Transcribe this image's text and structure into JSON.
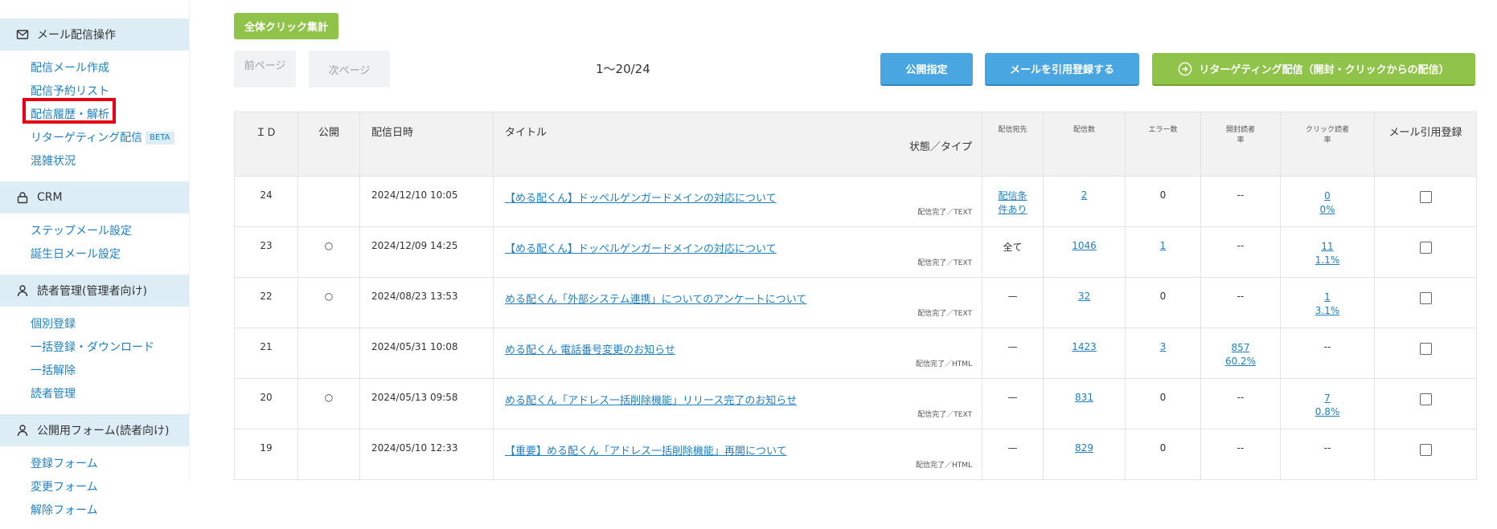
{
  "sidebar": {
    "sections": [
      {
        "title": "メール配信操作",
        "icon": "mail-icon",
        "items": [
          {
            "label": "配信メール作成"
          },
          {
            "label": "配信予約リスト"
          },
          {
            "label": "配信履歴・解析",
            "active": true
          },
          {
            "label": "リターゲティング配信",
            "badge": "BETA"
          },
          {
            "label": "混雑状況"
          }
        ]
      },
      {
        "title": "CRM",
        "icon": "lock-icon",
        "items": [
          {
            "label": "ステップメール設定"
          },
          {
            "label": "誕生日メール設定"
          }
        ]
      },
      {
        "title": "読者管理(管理者向け)",
        "icon": "user-icon",
        "items": [
          {
            "label": "個別登録"
          },
          {
            "label": "一括登録・ダウンロード"
          },
          {
            "label": "一括解除"
          },
          {
            "label": "読者管理"
          }
        ]
      },
      {
        "title": "公開用フォーム(読者向け)",
        "icon": "user-icon",
        "items": [
          {
            "label": "登録フォーム"
          },
          {
            "label": "変更フォーム"
          },
          {
            "label": "解除フォーム"
          }
        ]
      }
    ]
  },
  "toolbar": {
    "total_click_label": "全体クリック集計",
    "prev_label": "前ページ",
    "next_label": "次ページ",
    "range": "1〜20/24",
    "publish_label": "公開指定",
    "quote_label": "メールを引用登録する",
    "retarget_label": "リターゲティング配信（開封・クリックからの配信）"
  },
  "table": {
    "headers": {
      "id": "ＩＤ",
      "public": "公開",
      "date": "配信日時",
      "title": "タイトル",
      "status_type": "状態／タイプ",
      "dest": "配信宛先",
      "count": "配信数",
      "errors": "エラー数",
      "open_rate_1": "開封読者",
      "open_rate_2": "率",
      "click_rate_1": "クリック読者",
      "click_rate_2": "率",
      "quote": "メール引用登録"
    },
    "rows": [
      {
        "id": "24",
        "public": "",
        "date": "2024/12/10 10:05",
        "title": "【める配くん】ドッペルゲンガードメインの対応について",
        "status": "配信完了／TEXT",
        "dest": "配信条件あり",
        "dest_link": true,
        "count": "2",
        "errors": "0",
        "errors_link": false,
        "open1": "--",
        "open2": "",
        "click1": "0",
        "click2": "0%",
        "click_link": true
      },
      {
        "id": "23",
        "public": "○",
        "date": "2024/12/09 14:25",
        "title": "【める配くん】ドッペルゲンガードメインの対応について",
        "status": "配信完了／TEXT",
        "dest": "全て",
        "dest_link": false,
        "count": "1046",
        "errors": "1",
        "errors_link": true,
        "open1": "--",
        "open2": "",
        "click1": "11",
        "click2": "1.1%",
        "click_link": true
      },
      {
        "id": "22",
        "public": "○",
        "date": "2024/08/23 13:53",
        "title": "める配くん「外部システム連携」についてのアンケートについて",
        "status": "配信完了／TEXT",
        "dest": "—",
        "dest_link": false,
        "count": "32",
        "errors": "0",
        "errors_link": false,
        "open1": "--",
        "open2": "",
        "click1": "1",
        "click2": "3.1%",
        "click_link": true
      },
      {
        "id": "21",
        "public": "",
        "date": "2024/05/31 10:08",
        "title": "める配くん 電話番号変更のお知らせ",
        "status": "配信完了／HTML",
        "dest": "—",
        "dest_link": false,
        "count": "1423",
        "errors": "3",
        "errors_link": true,
        "open1": "857",
        "open2": "60.2%",
        "open_link": true,
        "click1": "--",
        "click2": "",
        "click_link": false
      },
      {
        "id": "20",
        "public": "○",
        "date": "2024/05/13 09:58",
        "title": "める配くん「アドレス一括削除機能」リリース完了のお知らせ",
        "status": "配信完了／TEXT",
        "dest": "—",
        "dest_link": false,
        "count": "831",
        "errors": "0",
        "errors_link": false,
        "open1": "--",
        "open2": "",
        "click1": "7",
        "click2": "0.8%",
        "click_link": true
      },
      {
        "id": "19",
        "public": "",
        "date": "2024/05/10 12:33",
        "title": "【重要】める配くん「アドレス一括削除機能」再開について",
        "status": "配信完了／HTML",
        "dest": "—",
        "dest_link": false,
        "count": "829",
        "errors": "0",
        "errors_link": false,
        "open1": "--",
        "open2": "",
        "click1": "--",
        "click2": "",
        "click_link": false
      }
    ]
  },
  "colors": {
    "accent_blue": "#4aa6e0",
    "accent_green": "#8fc34a",
    "link": "#1f7fc3",
    "highlight_red": "#e60012",
    "section_bg": "#dcedf6"
  }
}
